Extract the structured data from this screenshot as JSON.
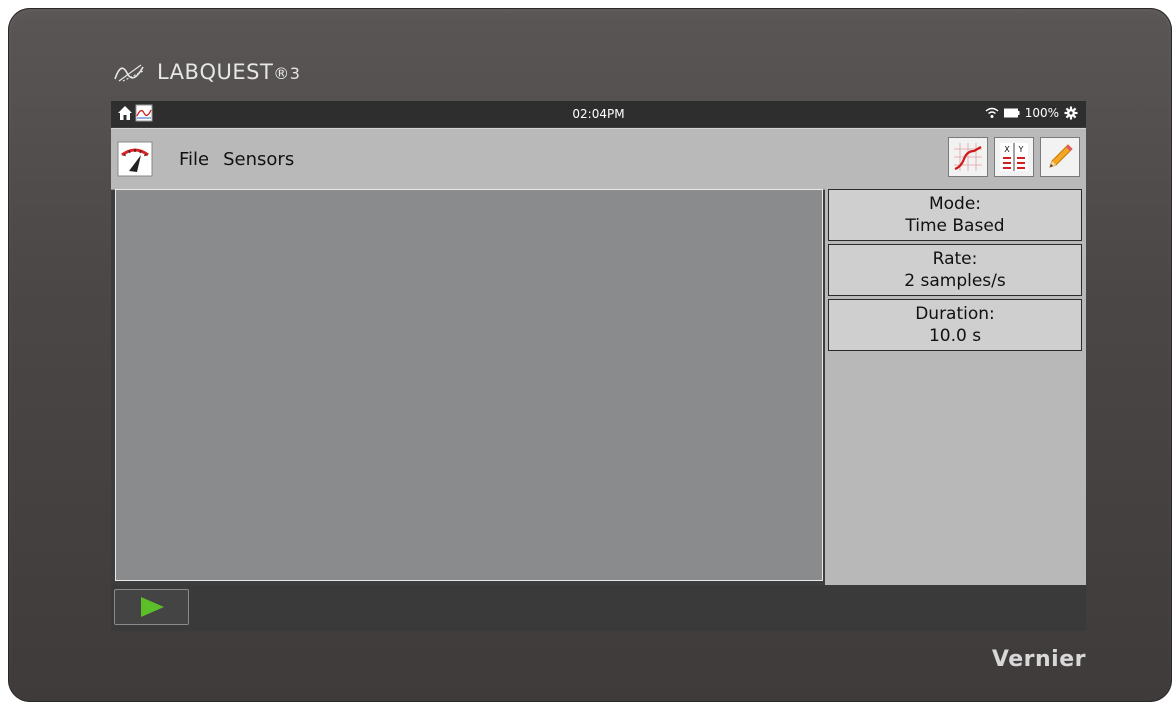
{
  "device": {
    "brand_main": "LABQUEST",
    "brand_suffix": "®3",
    "manufacturer": "Vernier"
  },
  "status_bar": {
    "time": "02:04PM",
    "battery": "100%",
    "icons": [
      "home-icon",
      "graph-thumbnail-icon",
      "wifi-icon",
      "battery-icon",
      "settings-gear-icon"
    ]
  },
  "toolbar": {
    "menu": {
      "file": "File",
      "sensors": "Sensors"
    },
    "icons": [
      "meter-icon",
      "graph-view-icon",
      "table-view-icon",
      "notes-pencil-icon"
    ]
  },
  "settings": {
    "mode": {
      "label": "Mode:",
      "value": "Time Based"
    },
    "rate": {
      "label": "Rate:",
      "value": "2 samples/s"
    },
    "duration": {
      "label": "Duration:",
      "value": "10.0 s"
    }
  },
  "bottom_bar": {
    "icons": [
      "play-icon"
    ]
  },
  "colors": {
    "play_green": "#5cbf2a",
    "graph_background": "#8a8b8c",
    "toolbar_background": "#b9b9b9"
  }
}
